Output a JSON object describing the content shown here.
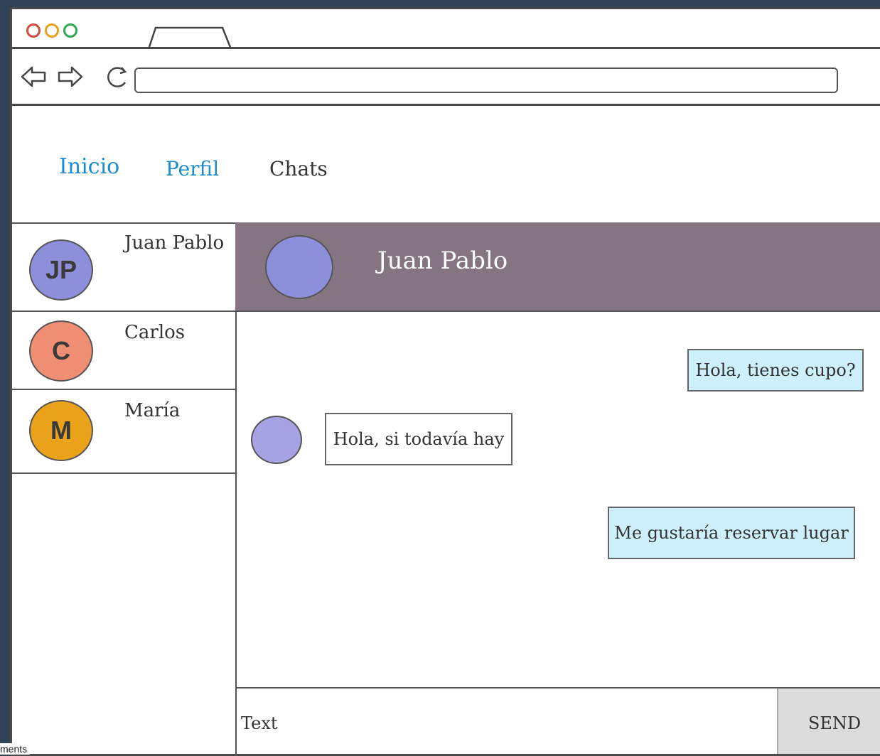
{
  "browser": {
    "url_value": ""
  },
  "menu": {
    "inicio": "Inicio",
    "perfil": "Perfil",
    "chats": "Chats"
  },
  "contacts": [
    {
      "initials": "JP",
      "name": "Juan Pablo",
      "color": "#8e8fdb"
    },
    {
      "initials": "C",
      "name": "Carlos",
      "color": "#ef8e72"
    },
    {
      "initials": "M",
      "name": "María",
      "color": "#e9a21a"
    }
  ],
  "chat": {
    "header_name": "Juan Pablo",
    "header_color": "#857583",
    "messages": [
      {
        "direction": "out",
        "text": "Hola, tienes cupo?"
      },
      {
        "direction": "in",
        "text": "Hola, si todavía hay"
      },
      {
        "direction": "out",
        "text": "Me gustaría reservar lugar"
      }
    ],
    "outgoing_bubble_color": "#cdf0fc"
  },
  "composer": {
    "placeholder": "Text",
    "send_label": "SEND"
  },
  "footer": {
    "text": "ments"
  }
}
